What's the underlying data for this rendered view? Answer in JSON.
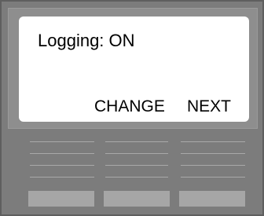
{
  "screen": {
    "status_text": "Logging: ON",
    "softkeys": {
      "change_label": "CHANGE",
      "next_label": "NEXT"
    }
  }
}
